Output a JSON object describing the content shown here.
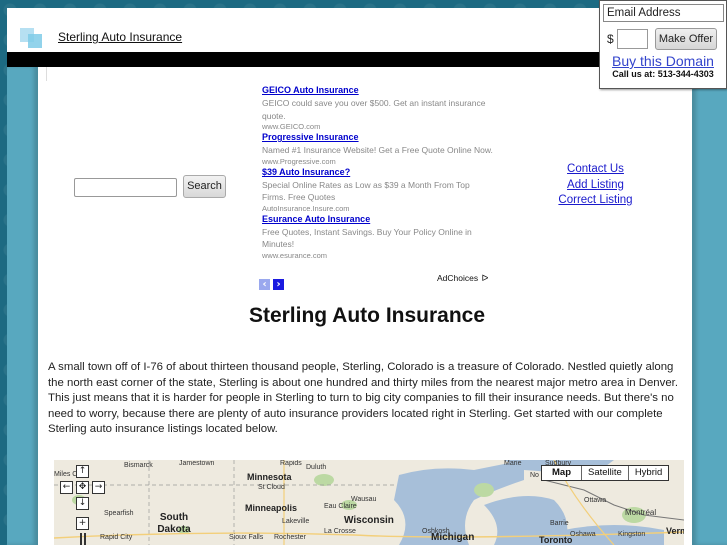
{
  "header": {
    "site_title": "Sterling Auto Insurance"
  },
  "search": {
    "input_value": "",
    "button_label": "Search"
  },
  "ads": {
    "items": [
      {
        "title": "GEICO Auto Insurance",
        "description": "GEICO could save you over $500. Get an instant insurance quote.",
        "url": "www.GEICO.com"
      },
      {
        "title": "Progressive Insurance",
        "description": "Named #1 Insurance Website! Get a Free Quote Online Now.",
        "url": "www.Progressive.com"
      },
      {
        "title": "$39 Auto Insurance?",
        "description": "Special Online Rates as Low as $39 a Month From Top Firms. Free Quotes",
        "url": "AutoInsurance.Insure.com"
      },
      {
        "title": "Esurance Auto Insurance",
        "description": "Free Quotes, Instant Savings. Buy Your Policy Online in Minutes!",
        "url": "www.esurance.com"
      }
    ],
    "prev_icon": "‹",
    "next_icon": "›",
    "adchoices_label": "AdChoices",
    "adchoices_icon": "ᐅ"
  },
  "links": {
    "items": [
      "Contact Us",
      "Add Listing",
      "Correct Listing"
    ]
  },
  "main": {
    "heading": "Sterling Auto Insurance",
    "intro": "A small town off of I-76 of about thirteen thousand people, Sterling, Colorado is a treasure of Colorado. Nestled quietly along the north east corner of the state, Sterling is about one hundred and thirty miles from the nearest major metro area in Denver. This just means that it is harder for people in Sterling to turn to big city companies to fill their insurance needs. But there's no need to worry, because there are plenty of auto insurance providers located right in Sterling. Get started with our complete Sterling auto insurance listings located below."
  },
  "map": {
    "type_buttons": [
      "Map",
      "Satellite",
      "Hybrid"
    ],
    "selected_type": "Map",
    "controls": {
      "pan_up": "↑",
      "pan_left": "←",
      "pan_center": "✥",
      "pan_right": "→",
      "pan_down": "↓",
      "zoom_in": "+"
    },
    "labels": {
      "bismarck": "Bismarck",
      "jamestown": "Jamestown",
      "miles_city": "Miles C",
      "rapids": "Rapids",
      "duluth": "Duluth",
      "minnesota": "Minnesota",
      "st_cloud": "St Cloud",
      "minneapolis": "Minneapolis",
      "eau_claire": "Eau Claire",
      "wausau": "Wausau",
      "lakeville": "Lakeville",
      "wisconsin": "Wisconsin",
      "la_crosse": "La Crosse",
      "oshkosh": "Oshkosh",
      "rochester": "Rochester",
      "michigan": "Michigan",
      "spearfish": "Spearfish",
      "south_dakota": "South Dakota",
      "rapid_city": "Rapid City",
      "sioux_falls": "Sioux Falls",
      "sudbury": "Sudbury",
      "marie": "Marie",
      "ottawa": "Ottawa",
      "montreal": "Montréal",
      "barrie": "Barrie",
      "oshawa": "Oshawa",
      "kingston": "Kingston",
      "toronto": "Toronto",
      "vermont": "Vermo",
      "no": "No"
    }
  },
  "domain_offer": {
    "email_placeholder": "Email Address",
    "currency_symbol": "$",
    "offer_value": "",
    "make_offer_label": "Make Offer",
    "buy_link": "Buy this Domain",
    "call_us": "Call us at: 513-344-4303"
  }
}
